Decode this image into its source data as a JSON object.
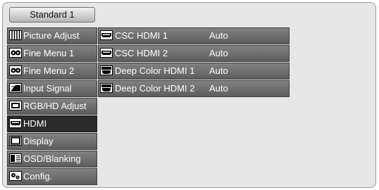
{
  "tab": {
    "label": "Standard 1"
  },
  "menu": [
    {
      "label": "Picture Adjust",
      "icon": "picture-adjust-icon"
    },
    {
      "label": "Fine Menu 1",
      "icon": "fine-menu-icon"
    },
    {
      "label": "Fine Menu 2",
      "icon": "fine-menu-icon"
    },
    {
      "label": "Input Signal",
      "icon": "input-signal-icon"
    },
    {
      "label": "RGB/HD Adjust",
      "icon": "rgb-hd-adjust-icon"
    },
    {
      "label": "HDMI",
      "icon": "hdmi-icon",
      "selected": true
    },
    {
      "label": "Display",
      "icon": "display-icon"
    },
    {
      "label": "OSD/Blanking",
      "icon": "osd-blanking-icon"
    },
    {
      "label": "Config.",
      "icon": "config-icon"
    }
  ],
  "settings": [
    {
      "label": "CSC HDMI 1",
      "value": "Auto",
      "icon": "hdmi-connector-icon"
    },
    {
      "label": "CSC HDMI 2",
      "value": "Auto",
      "icon": "hdmi-connector-icon"
    },
    {
      "label": "Deep Color HDMI 1",
      "value": "Auto",
      "icon": "deep-color-icon"
    },
    {
      "label": "Deep Color HDMI 2",
      "value": "Auto",
      "icon": "deep-color-icon"
    }
  ],
  "colors": {
    "panel": "#e6e6e6",
    "item": "#707070",
    "selected": "#2b2b2b",
    "text": "#ffffff"
  }
}
